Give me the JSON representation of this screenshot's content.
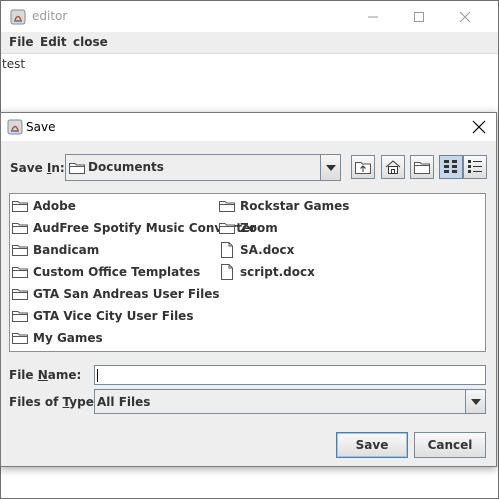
{
  "editor_window": {
    "title": "editor",
    "menu": [
      "File",
      "Edit",
      "close"
    ],
    "content_text": "test"
  },
  "save_dialog": {
    "title": "Save",
    "save_in_label_pre": "Save ",
    "save_in_label_underlined": "I",
    "save_in_label_post": "n:",
    "save_in_value": "Documents",
    "toolbar": [
      {
        "name": "up-one-level-icon"
      },
      {
        "name": "home-icon"
      },
      {
        "name": "new-folder-icon"
      },
      {
        "name": "list-view-icon",
        "pressed": true
      },
      {
        "name": "details-view-icon"
      }
    ],
    "files_col1": [
      {
        "name": "Adobe",
        "type": "folder"
      },
      {
        "name": "AudFree Spotify Music Converter",
        "type": "folder"
      },
      {
        "name": "Bandicam",
        "type": "folder"
      },
      {
        "name": "Custom Office Templates",
        "type": "folder"
      },
      {
        "name": "GTA San Andreas User Files",
        "type": "folder"
      },
      {
        "name": "GTA Vice City User Files",
        "type": "folder"
      },
      {
        "name": "My Games",
        "type": "folder"
      }
    ],
    "files_col2": [
      {
        "name": "Rockstar Games",
        "type": "folder"
      },
      {
        "name": "Zoom",
        "type": "folder"
      },
      {
        "name": "SA.docx",
        "type": "file"
      },
      {
        "name": "script.docx",
        "type": "file"
      }
    ],
    "file_name_label_pre": "File ",
    "file_name_label_underlined": "N",
    "file_name_label_post": "ame:",
    "file_name_value": "",
    "files_of_type_label_pre": "Files of ",
    "files_of_type_label_underlined": "T",
    "files_of_type_label_post": "ype:",
    "files_of_type_value": "All Files",
    "save_button": "Save",
    "cancel_button": "Cancel"
  }
}
